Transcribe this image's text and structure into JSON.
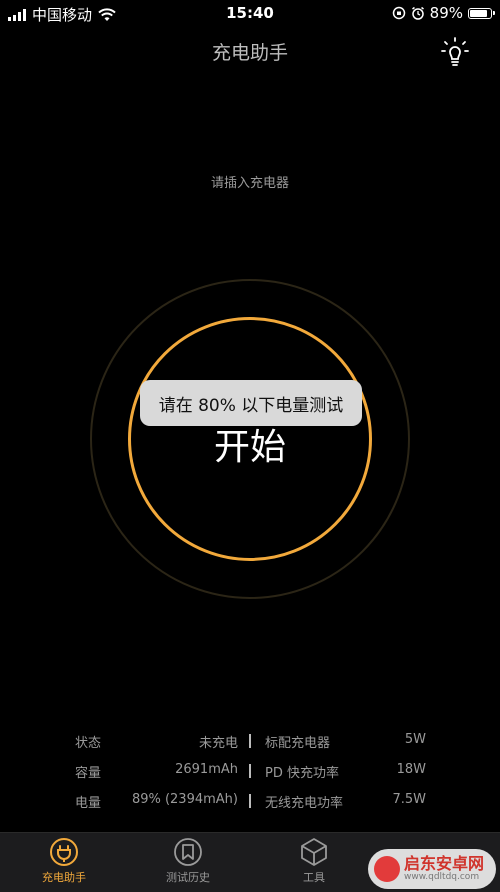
{
  "status_bar": {
    "carrier": "中国移动",
    "time": "15:40",
    "battery_text": "89%",
    "battery_level": 0.89
  },
  "header": {
    "title": "充电助手",
    "light_icon": "lightbulb-icon"
  },
  "hint": "请插入充电器",
  "main": {
    "start_label": "开始",
    "toast": "请在 80% 以下电量测试",
    "colors": {
      "ring": "#f2a93b",
      "outer_ring": "#2b2516"
    }
  },
  "stats": [
    {
      "label1": "状态",
      "value1": "未充电",
      "label2": "标配充电器",
      "value2": "5W"
    },
    {
      "label1": "容量",
      "value1": "2691mAh",
      "label2": "PD 快充功率",
      "value2": "18W"
    },
    {
      "label1": "电量",
      "value1": "89% (2394mAh)",
      "label2": "无线充电功率",
      "value2": "7.5W"
    }
  ],
  "tabs": [
    {
      "label": "充电助手",
      "icon": "charger-plug-icon",
      "active": true
    },
    {
      "label": "测试历史",
      "icon": "history-icon",
      "active": false
    },
    {
      "label": "工具",
      "icon": "tools-box-icon",
      "active": false
    }
  ],
  "watermark": {
    "title": "启东安卓网",
    "url": "www.qdltdq.com"
  },
  "accent_color": "#f2a93b"
}
